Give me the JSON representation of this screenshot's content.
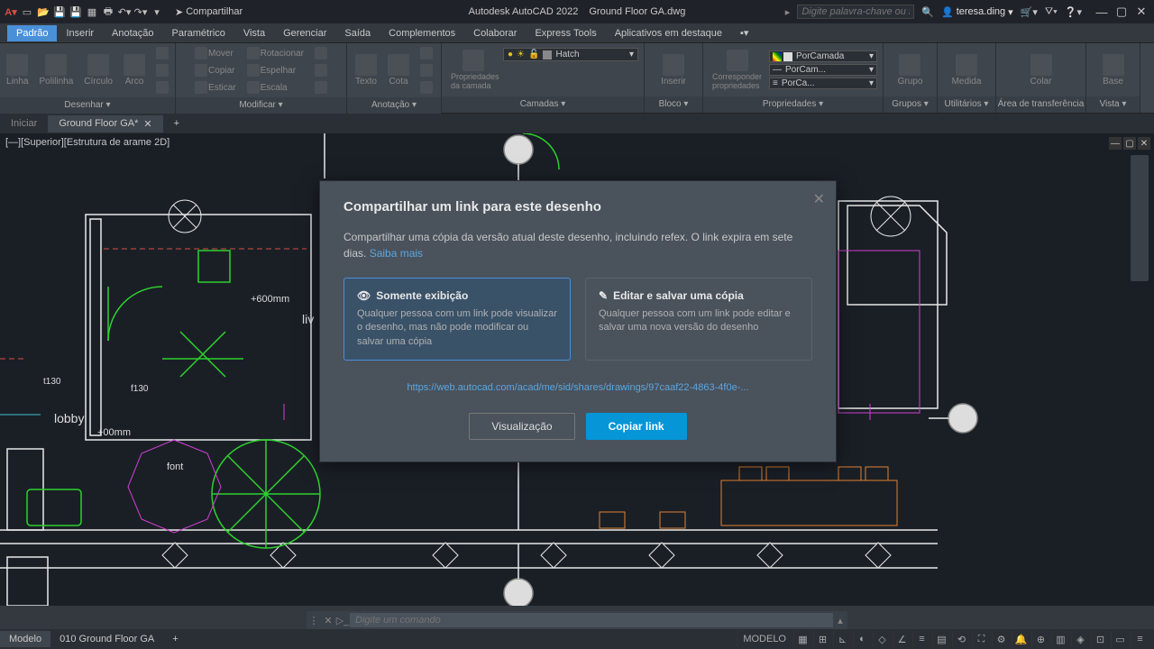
{
  "app": {
    "name": "Autodesk AutoCAD 2022",
    "file": "Ground Floor  GA.dwg"
  },
  "qat_share": "Compartilhar",
  "search": {
    "placeholder": "Digite palavra-chave ou frase"
  },
  "user": {
    "name": "teresa.ding"
  },
  "menu": [
    "Padrão",
    "Inserir",
    "Anotação",
    "Paramétrico",
    "Vista",
    "Gerenciar",
    "Saída",
    "Complementos",
    "Colaborar",
    "Express Tools",
    "Aplicativos em destaque"
  ],
  "ribbon": {
    "draw": {
      "title": "Desenhar ▾",
      "items": [
        "Linha",
        "Polilinha",
        "Círculo",
        "Arco"
      ]
    },
    "modify": {
      "title": "Modificar ▾",
      "items": [
        "Mover",
        "Rotacionar",
        "Copiar",
        "Espelhar",
        "Esticar",
        "Escala"
      ]
    },
    "annot": {
      "title": "Anotação ▾",
      "items": [
        "Texto",
        "Cota"
      ]
    },
    "layers": {
      "title": "Camadas ▾",
      "prop": "Propriedades da camada",
      "combo": "Hatch"
    },
    "block": {
      "title": "Bloco ▾",
      "items": [
        "Inserir"
      ]
    },
    "props": {
      "title": "Propriedades ▾",
      "match": "Corresponder propriedades",
      "c1": "PorCamada",
      "c2": "PorCam...",
      "c3": "PorCa..."
    },
    "groups": {
      "title": "Grupos ▾",
      "item": "Grupo"
    },
    "utils": {
      "title": "Utilitários ▾",
      "item": "Medida"
    },
    "clip": {
      "title": "Área de transferência",
      "item": "Colar"
    },
    "view": {
      "title": "Vista ▾",
      "item": "Base"
    }
  },
  "doctabs": {
    "start": "Iniciar",
    "active": "Ground Floor  GA*"
  },
  "viewport_label": "[—][Superior][Estrutura de arame 2D]",
  "canvas_text": {
    "dim1": "+600mm",
    "dim2": "+00mm",
    "lobby": "lobby",
    "liv": "liv",
    "font": "font",
    "t1": "t130",
    "f1": "f130"
  },
  "dialog": {
    "title": "Compartilhar um link para este desenho",
    "desc": "Compartilhar uma cópia da versão atual deste desenho, incluindo refex. O link expira em sete dias. ",
    "learn": "Saiba mais",
    "opt1": {
      "title": "Somente exibição",
      "desc": "Qualquer pessoa com um link pode visualizar o desenho, mas não pode modificar ou salvar uma cópia"
    },
    "opt2": {
      "title": "Editar e salvar uma cópia",
      "desc": "Qualquer pessoa com um link pode editar e salvar uma nova versão do desenho"
    },
    "url": "https://web.autocad.com/acad/me/sid/shares/drawings/97caaf22-4863-4f0e-...",
    "preview": "Visualização",
    "copy": "Copiar link"
  },
  "cmd": {
    "placeholder": "Digite um comando"
  },
  "layout": {
    "model": "Modelo",
    "l1": "010 Ground Floor GA"
  },
  "status_model": "MODELO"
}
